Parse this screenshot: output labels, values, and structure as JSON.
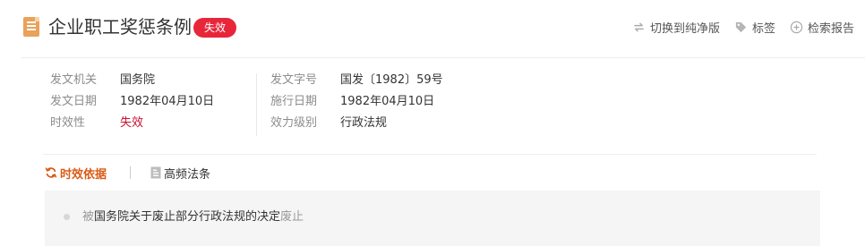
{
  "header": {
    "title": "企业职工奖惩条例",
    "status_badge": "失效",
    "toolbar": [
      {
        "label": "切换到纯净版",
        "icon": "switch-icon"
      },
      {
        "label": "标签",
        "icon": "tag-icon"
      },
      {
        "label": "检索报告",
        "icon": "add-circle-icon"
      }
    ]
  },
  "meta": {
    "left": [
      {
        "label": "发文机关",
        "value": "国务院"
      },
      {
        "label": "发文日期",
        "value": "1982年04月10日"
      },
      {
        "label": "时效性",
        "value": "失效"
      }
    ],
    "right": [
      {
        "label": "发文字号",
        "value": "国发〔1982〕59号"
      },
      {
        "label": "施行日期",
        "value": "1982年04月10日"
      },
      {
        "label": "效力级别",
        "value": "行政法规"
      }
    ]
  },
  "tabs": [
    {
      "label": "时效依据",
      "icon": "refresh-icon"
    },
    {
      "label": "高频法条",
      "icon": "document-icon"
    }
  ],
  "relation": {
    "prefix": "被",
    "link": "国务院关于废止部分行政法规的决定",
    "suffix": "废止"
  },
  "colors": {
    "badge": "#e8263a",
    "invalid_text": "#c8102e",
    "active_tab": "#d95c18",
    "doc_icon": "#e8a25a"
  }
}
